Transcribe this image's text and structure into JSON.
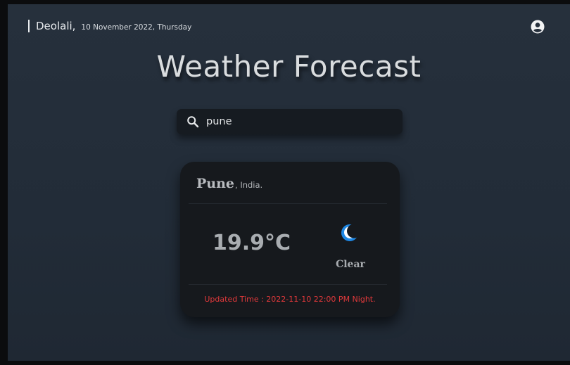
{
  "header": {
    "city": "Deolali,",
    "date": "10 November 2022, Thursday"
  },
  "title": "Weather Forecast",
  "search": {
    "value": "pune",
    "icon": "search-icon"
  },
  "user": {
    "icon": "user-circle-icon"
  },
  "card": {
    "city": "Pune",
    "country": ", India.",
    "temperature": "19.9°C",
    "condition": "Clear",
    "condition_icon": "moon-icon",
    "updated": "Updated Time : 2022-11-10 22:00 PM Night."
  },
  "colors": {
    "background": "#222c38",
    "card": "#16191d",
    "moon": "#1e88e5",
    "updated_text": "#e2393b"
  }
}
